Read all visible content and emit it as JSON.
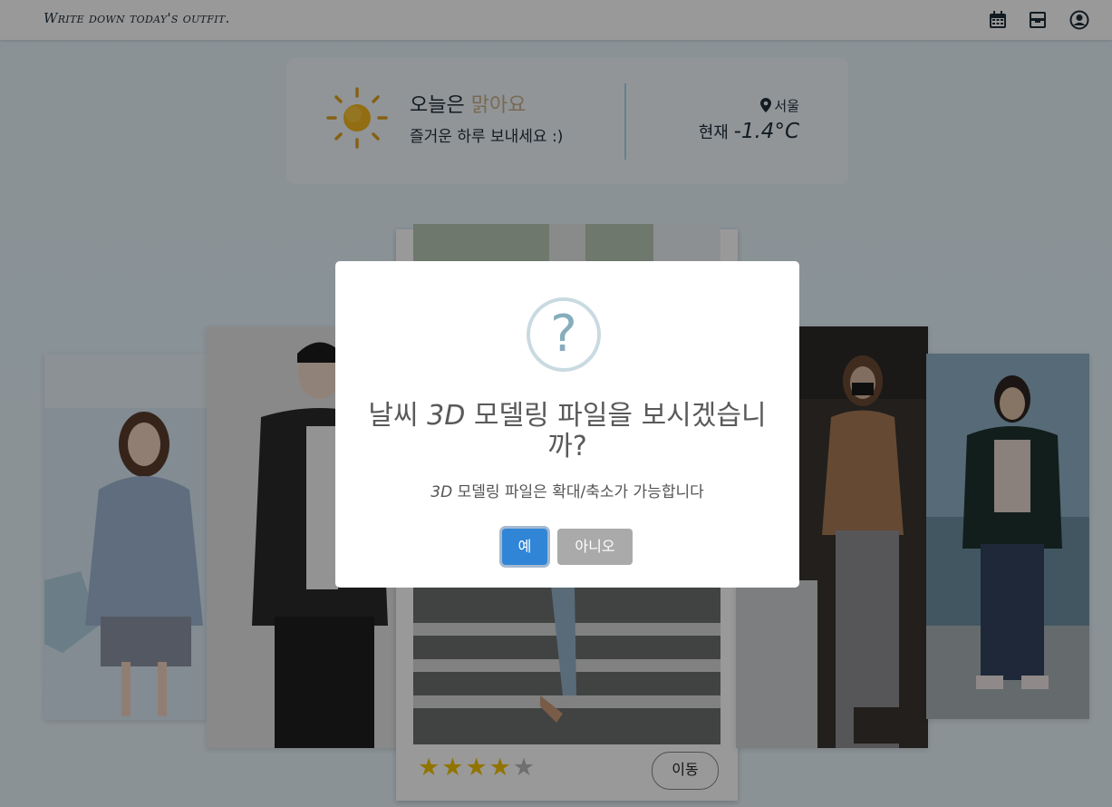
{
  "header": {
    "brand": "Write down today's outfit.",
    "icons": [
      "calendar-icon",
      "archive-icon",
      "user-circle-icon"
    ]
  },
  "weather": {
    "title_prefix": "오늘은",
    "condition": "맑아요",
    "subtitle": "즐거운 하루 보내세요 :)",
    "location": "서울",
    "temp_label": "현재",
    "temp_value": "-1.4°C",
    "icon": "sun-icon"
  },
  "outfit_card": {
    "rating": 4,
    "rating_max": 5,
    "move_label": "이동"
  },
  "modal": {
    "icon": "question-icon",
    "title_part1": "날씨",
    "title_em": "3D",
    "title_part2": "모델링 파일을 보시겠습니까?",
    "text_em": "3D",
    "text": "모델링 파일은 확대/축소가 가능합니다",
    "confirm_label": "예",
    "cancel_label": "아니오"
  },
  "colors": {
    "confirm": "#3085d6",
    "cancel": "#aaaaaa",
    "star": "#f2c200",
    "highlight": "#c9b08a"
  }
}
